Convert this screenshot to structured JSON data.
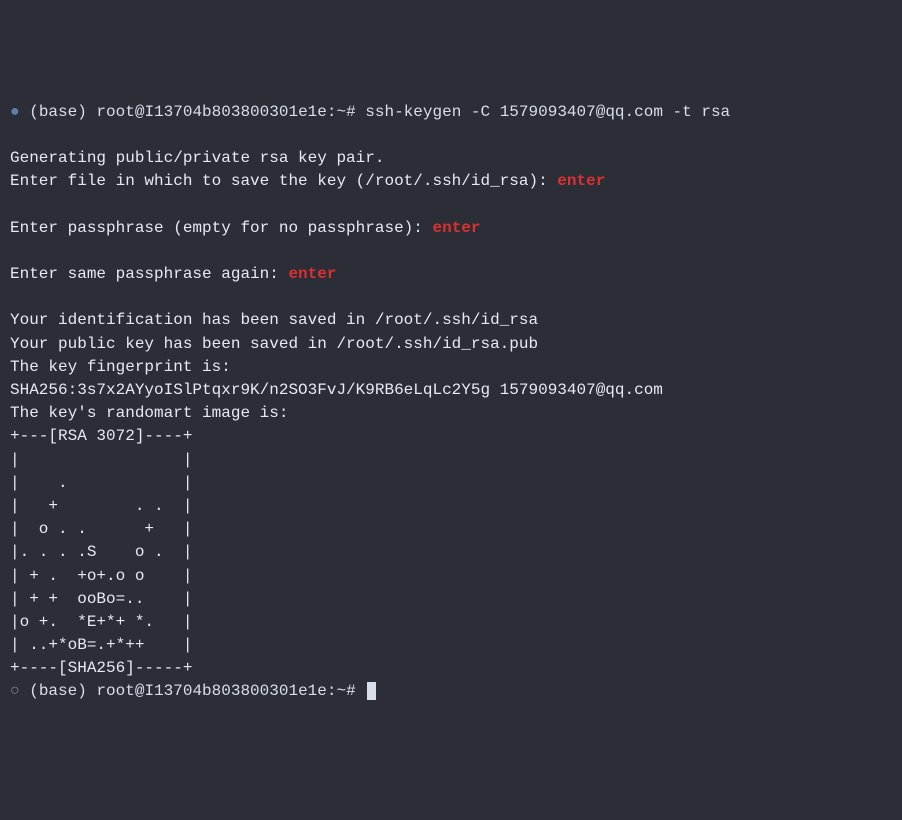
{
  "line1": {
    "bullet": "●",
    "prompt": "(base) root@I13704b803800301e1e:~#",
    "command": "ssh-keygen -C 1579093407@qq.com -t rsa"
  },
  "line2": "Generating public/private rsa key pair.",
  "line3": {
    "text": "Enter file in which to save the key (/root/.ssh/id_rsa):",
    "annotation": "enter"
  },
  "line4": {
    "text": "Enter passphrase (empty for no passphrase):",
    "annotation": "enter"
  },
  "line5": {
    "text": "Enter same passphrase again:",
    "annotation": "enter"
  },
  "line6": "Your identification has been saved in /root/.ssh/id_rsa",
  "line7": "Your public key has been saved in /root/.ssh/id_rsa.pub",
  "line8": "The key fingerprint is:",
  "line9": "SHA256:3s7x2AYyoISlPtqxr9K/n2SO3FvJ/K9RB6eLqLc2Y5g 1579093407@qq.com",
  "line10": "The key's randomart image is:",
  "art": [
    "+---[RSA 3072]----+",
    "|                 |",
    "|    .            |",
    "|   +        . .  |",
    "|  o . .      +   |",
    "|. . . .S    o .  |",
    "| + .  +o+.o o    |",
    "| + +  ooBo=..    |",
    "|o +.  *E+*+ *.   |",
    "| ..+*oB=.+*++    |",
    "+----[SHA256]-----+"
  ],
  "lastline": {
    "bullet": "○",
    "prompt": "(base) root@I13704b803800301e1e:~#"
  }
}
